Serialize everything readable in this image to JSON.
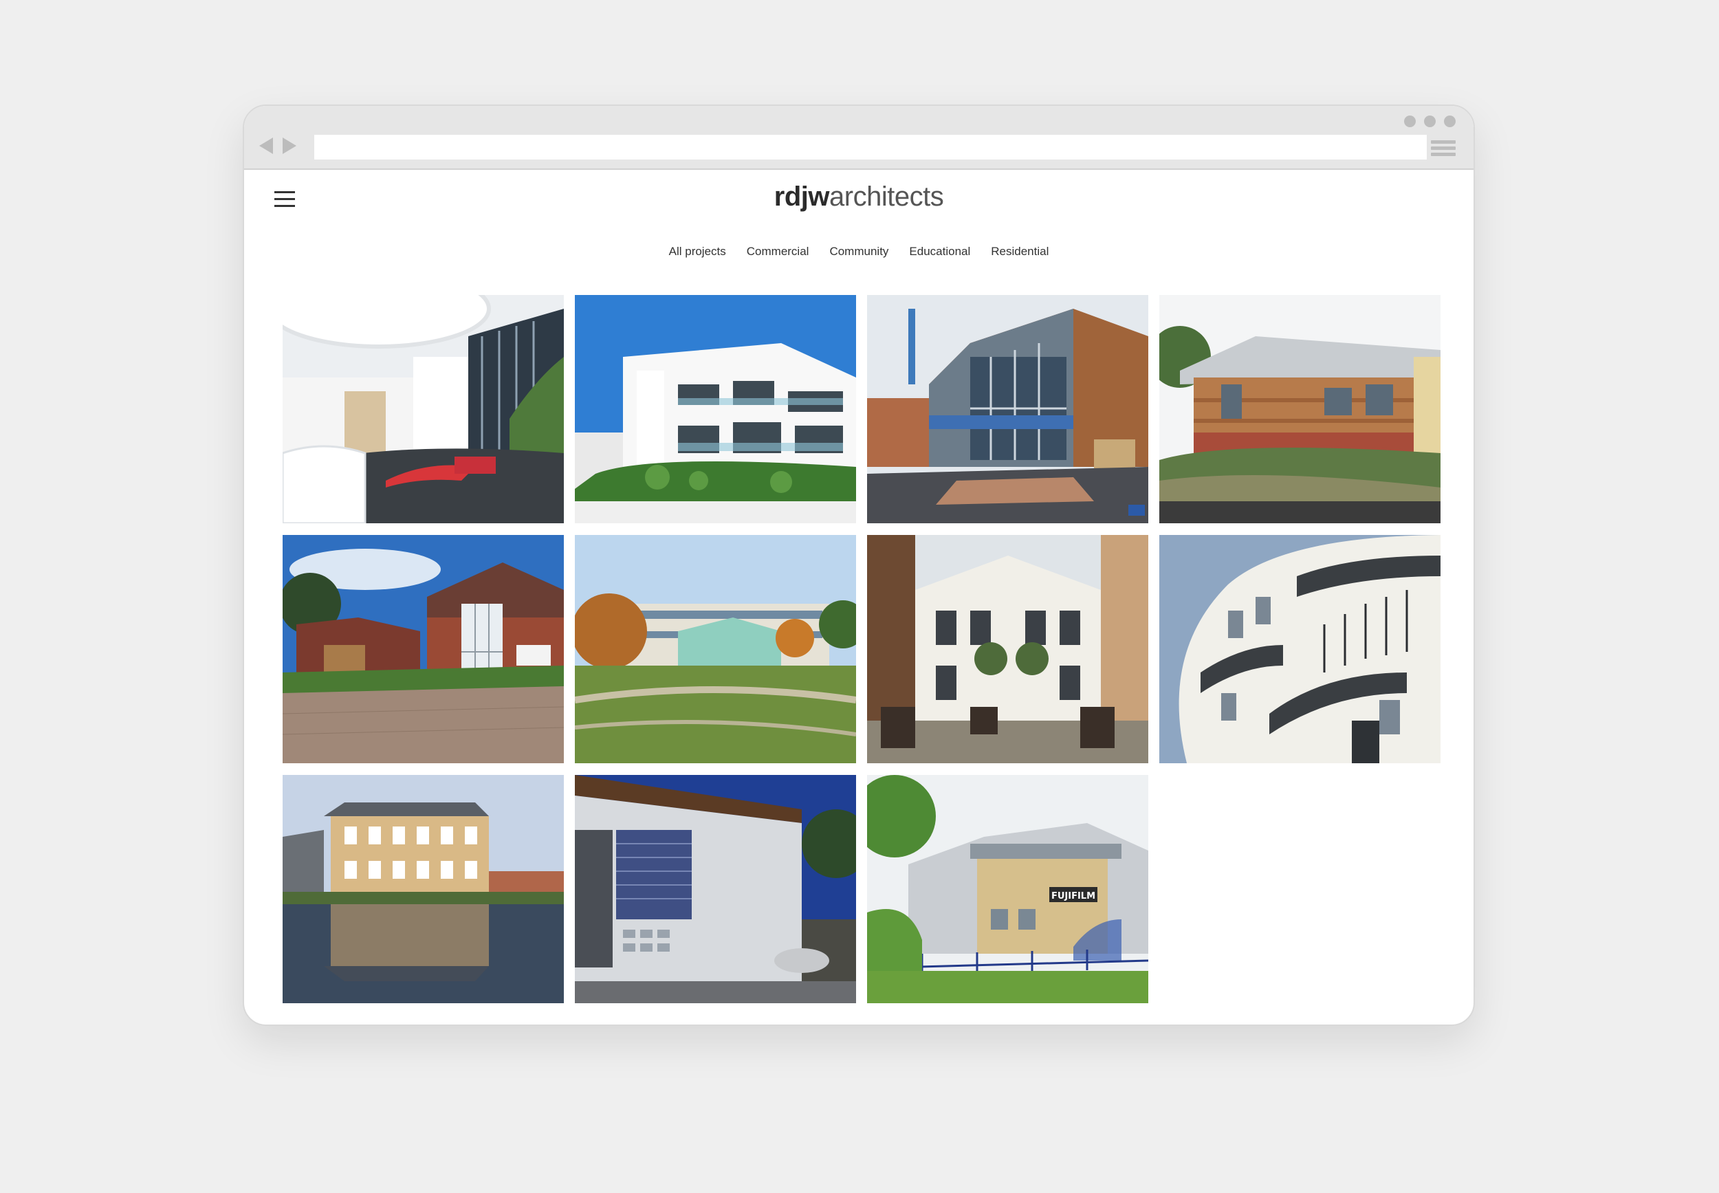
{
  "browser": {
    "address": "",
    "icons": [
      "back-arrow-icon",
      "forward-arrow-icon",
      "browser-menu-icon"
    ]
  },
  "site": {
    "logo_bold": "rdjw",
    "logo_light": "architects",
    "menu_icon": "hamburger-menu-icon"
  },
  "filters": [
    "All projects",
    "Commercial",
    "Community",
    "Educational",
    "Residential"
  ],
  "projects": [
    {
      "kind": "interior-lobby"
    },
    {
      "kind": "white-apartments"
    },
    {
      "kind": "community-centre"
    },
    {
      "kind": "timber-building"
    },
    {
      "kind": "brick-house"
    },
    {
      "kind": "school-park"
    },
    {
      "kind": "courtyard-facade"
    },
    {
      "kind": "curved-terrace"
    },
    {
      "kind": "riverside-office"
    },
    {
      "kind": "industrial-unit"
    },
    {
      "kind": "fujifilm-building",
      "sign": "FUJIFILM"
    }
  ],
  "colors": {
    "page_bg": "#efefef",
    "chrome_bg": "#e6e6e6",
    "text": "#333333"
  }
}
